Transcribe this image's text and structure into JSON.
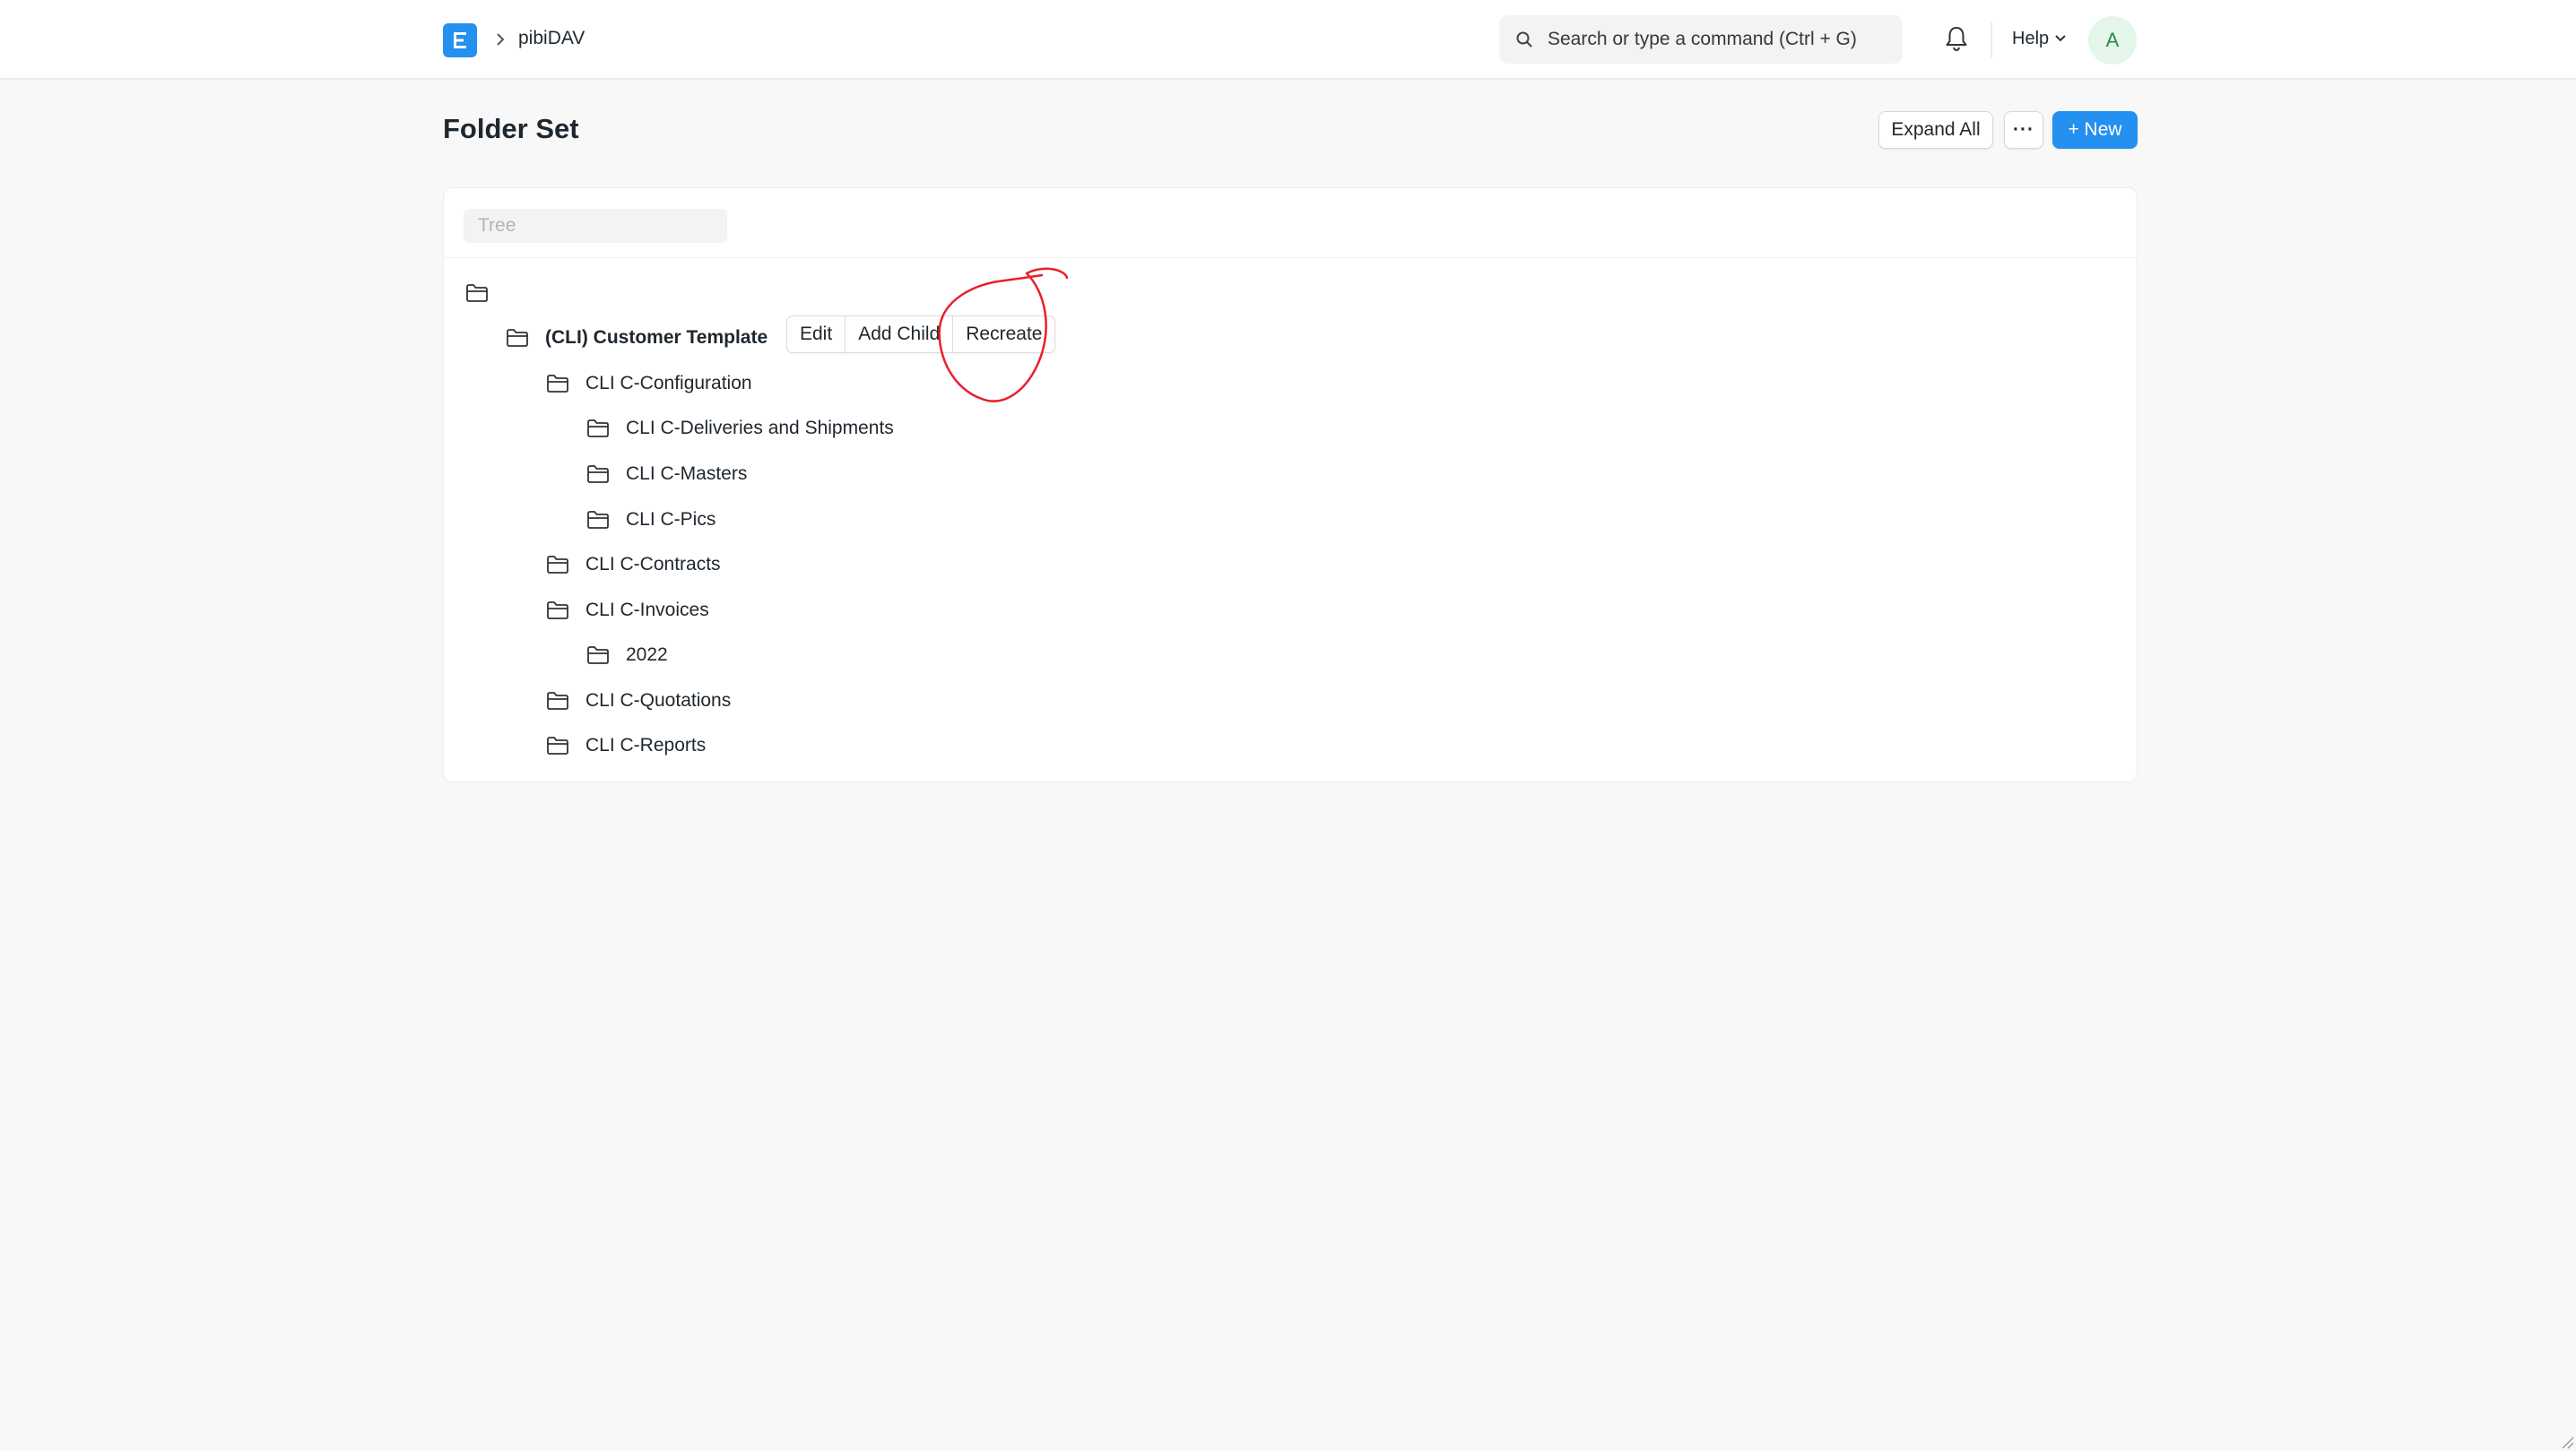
{
  "navbar": {
    "breadcrumb": "pibiDAV",
    "search_placeholder": "Search or type a command (Ctrl + G)",
    "help_label": "Help",
    "avatar_initial": "A"
  },
  "page": {
    "title": "Folder Set",
    "expand_all_label": "Expand All",
    "more_label": "···",
    "new_label": "+ New"
  },
  "tree": {
    "filter_placeholder": "Tree",
    "root_label": "",
    "nodes": [
      {
        "label": "(CLI) Customer Template",
        "level": 1
      },
      {
        "label": "CLI C-Configuration",
        "level": 2
      },
      {
        "label": "CLI C-Deliveries and Shipments",
        "level": 3
      },
      {
        "label": "CLI C-Masters",
        "level": 3
      },
      {
        "label": "CLI C-Pics",
        "level": 3
      },
      {
        "label": "CLI C-Contracts",
        "level": 2
      },
      {
        "label": "CLI C-Invoices",
        "level": 2
      },
      {
        "label": "2022",
        "level": 3
      },
      {
        "label": "CLI C-Quotations",
        "level": 2
      },
      {
        "label": "CLI C-Reports",
        "level": 2
      }
    ],
    "actions": {
      "edit": "Edit",
      "add_child": "Add Child",
      "recreate": "Recreate"
    }
  },
  "colors": {
    "primary": "#2490ef",
    "annotation": "#e8202a"
  }
}
